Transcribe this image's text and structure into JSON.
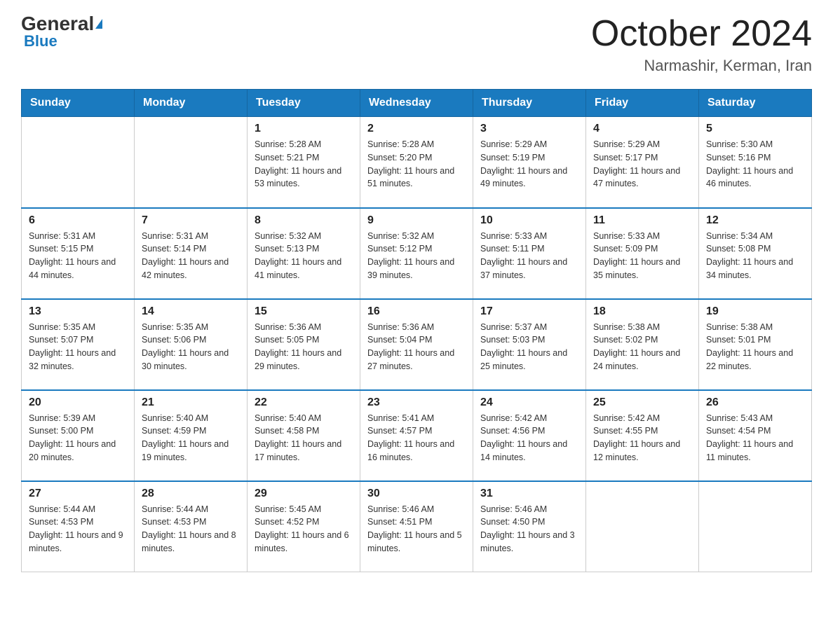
{
  "header": {
    "logo_general": "General",
    "logo_blue": "Blue",
    "month_title": "October 2024",
    "location": "Narmashir, Kerman, Iran"
  },
  "days_of_week": [
    "Sunday",
    "Monday",
    "Tuesday",
    "Wednesday",
    "Thursday",
    "Friday",
    "Saturday"
  ],
  "weeks": [
    [
      {
        "day": "",
        "sunrise": "",
        "sunset": "",
        "daylight": ""
      },
      {
        "day": "",
        "sunrise": "",
        "sunset": "",
        "daylight": ""
      },
      {
        "day": "1",
        "sunrise": "Sunrise: 5:28 AM",
        "sunset": "Sunset: 5:21 PM",
        "daylight": "Daylight: 11 hours and 53 minutes."
      },
      {
        "day": "2",
        "sunrise": "Sunrise: 5:28 AM",
        "sunset": "Sunset: 5:20 PM",
        "daylight": "Daylight: 11 hours and 51 minutes."
      },
      {
        "day": "3",
        "sunrise": "Sunrise: 5:29 AM",
        "sunset": "Sunset: 5:19 PM",
        "daylight": "Daylight: 11 hours and 49 minutes."
      },
      {
        "day": "4",
        "sunrise": "Sunrise: 5:29 AM",
        "sunset": "Sunset: 5:17 PM",
        "daylight": "Daylight: 11 hours and 47 minutes."
      },
      {
        "day": "5",
        "sunrise": "Sunrise: 5:30 AM",
        "sunset": "Sunset: 5:16 PM",
        "daylight": "Daylight: 11 hours and 46 minutes."
      }
    ],
    [
      {
        "day": "6",
        "sunrise": "Sunrise: 5:31 AM",
        "sunset": "Sunset: 5:15 PM",
        "daylight": "Daylight: 11 hours and 44 minutes."
      },
      {
        "day": "7",
        "sunrise": "Sunrise: 5:31 AM",
        "sunset": "Sunset: 5:14 PM",
        "daylight": "Daylight: 11 hours and 42 minutes."
      },
      {
        "day": "8",
        "sunrise": "Sunrise: 5:32 AM",
        "sunset": "Sunset: 5:13 PM",
        "daylight": "Daylight: 11 hours and 41 minutes."
      },
      {
        "day": "9",
        "sunrise": "Sunrise: 5:32 AM",
        "sunset": "Sunset: 5:12 PM",
        "daylight": "Daylight: 11 hours and 39 minutes."
      },
      {
        "day": "10",
        "sunrise": "Sunrise: 5:33 AM",
        "sunset": "Sunset: 5:11 PM",
        "daylight": "Daylight: 11 hours and 37 minutes."
      },
      {
        "day": "11",
        "sunrise": "Sunrise: 5:33 AM",
        "sunset": "Sunset: 5:09 PM",
        "daylight": "Daylight: 11 hours and 35 minutes."
      },
      {
        "day": "12",
        "sunrise": "Sunrise: 5:34 AM",
        "sunset": "Sunset: 5:08 PM",
        "daylight": "Daylight: 11 hours and 34 minutes."
      }
    ],
    [
      {
        "day": "13",
        "sunrise": "Sunrise: 5:35 AM",
        "sunset": "Sunset: 5:07 PM",
        "daylight": "Daylight: 11 hours and 32 minutes."
      },
      {
        "day": "14",
        "sunrise": "Sunrise: 5:35 AM",
        "sunset": "Sunset: 5:06 PM",
        "daylight": "Daylight: 11 hours and 30 minutes."
      },
      {
        "day": "15",
        "sunrise": "Sunrise: 5:36 AM",
        "sunset": "Sunset: 5:05 PM",
        "daylight": "Daylight: 11 hours and 29 minutes."
      },
      {
        "day": "16",
        "sunrise": "Sunrise: 5:36 AM",
        "sunset": "Sunset: 5:04 PM",
        "daylight": "Daylight: 11 hours and 27 minutes."
      },
      {
        "day": "17",
        "sunrise": "Sunrise: 5:37 AM",
        "sunset": "Sunset: 5:03 PM",
        "daylight": "Daylight: 11 hours and 25 minutes."
      },
      {
        "day": "18",
        "sunrise": "Sunrise: 5:38 AM",
        "sunset": "Sunset: 5:02 PM",
        "daylight": "Daylight: 11 hours and 24 minutes."
      },
      {
        "day": "19",
        "sunrise": "Sunrise: 5:38 AM",
        "sunset": "Sunset: 5:01 PM",
        "daylight": "Daylight: 11 hours and 22 minutes."
      }
    ],
    [
      {
        "day": "20",
        "sunrise": "Sunrise: 5:39 AM",
        "sunset": "Sunset: 5:00 PM",
        "daylight": "Daylight: 11 hours and 20 minutes."
      },
      {
        "day": "21",
        "sunrise": "Sunrise: 5:40 AM",
        "sunset": "Sunset: 4:59 PM",
        "daylight": "Daylight: 11 hours and 19 minutes."
      },
      {
        "day": "22",
        "sunrise": "Sunrise: 5:40 AM",
        "sunset": "Sunset: 4:58 PM",
        "daylight": "Daylight: 11 hours and 17 minutes."
      },
      {
        "day": "23",
        "sunrise": "Sunrise: 5:41 AM",
        "sunset": "Sunset: 4:57 PM",
        "daylight": "Daylight: 11 hours and 16 minutes."
      },
      {
        "day": "24",
        "sunrise": "Sunrise: 5:42 AM",
        "sunset": "Sunset: 4:56 PM",
        "daylight": "Daylight: 11 hours and 14 minutes."
      },
      {
        "day": "25",
        "sunrise": "Sunrise: 5:42 AM",
        "sunset": "Sunset: 4:55 PM",
        "daylight": "Daylight: 11 hours and 12 minutes."
      },
      {
        "day": "26",
        "sunrise": "Sunrise: 5:43 AM",
        "sunset": "Sunset: 4:54 PM",
        "daylight": "Daylight: 11 hours and 11 minutes."
      }
    ],
    [
      {
        "day": "27",
        "sunrise": "Sunrise: 5:44 AM",
        "sunset": "Sunset: 4:53 PM",
        "daylight": "Daylight: 11 hours and 9 minutes."
      },
      {
        "day": "28",
        "sunrise": "Sunrise: 5:44 AM",
        "sunset": "Sunset: 4:53 PM",
        "daylight": "Daylight: 11 hours and 8 minutes."
      },
      {
        "day": "29",
        "sunrise": "Sunrise: 5:45 AM",
        "sunset": "Sunset: 4:52 PM",
        "daylight": "Daylight: 11 hours and 6 minutes."
      },
      {
        "day": "30",
        "sunrise": "Sunrise: 5:46 AM",
        "sunset": "Sunset: 4:51 PM",
        "daylight": "Daylight: 11 hours and 5 minutes."
      },
      {
        "day": "31",
        "sunrise": "Sunrise: 5:46 AM",
        "sunset": "Sunset: 4:50 PM",
        "daylight": "Daylight: 11 hours and 3 minutes."
      },
      {
        "day": "",
        "sunrise": "",
        "sunset": "",
        "daylight": ""
      },
      {
        "day": "",
        "sunrise": "",
        "sunset": "",
        "daylight": ""
      }
    ]
  ]
}
